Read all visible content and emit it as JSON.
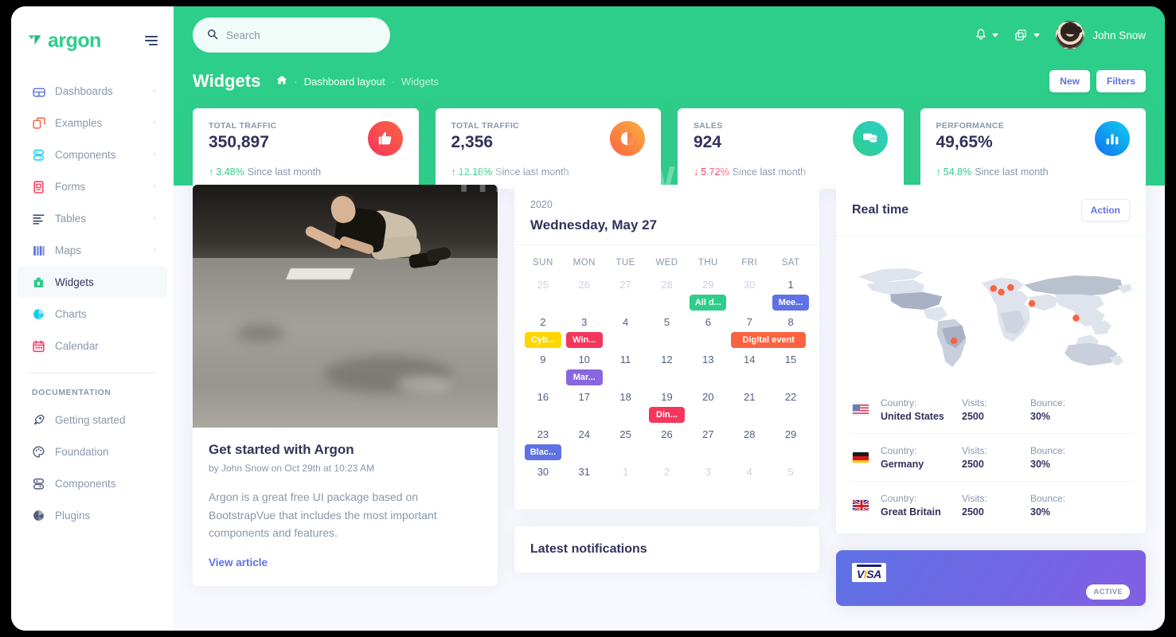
{
  "brand": {
    "name": "argon"
  },
  "sidebar": {
    "items": [
      {
        "label": "Dashboards",
        "icon": "dashboard-icon",
        "color": "#5e72e4",
        "chevron": "›",
        "active": false
      },
      {
        "label": "Examples",
        "icon": "examples-icon",
        "color": "#fb6340",
        "chevron": "›",
        "active": false
      },
      {
        "label": "Components",
        "icon": "components-icon",
        "color": "#11cdef",
        "chevron": "›",
        "active": false
      },
      {
        "label": "Forms",
        "icon": "forms-icon",
        "color": "#f5365c",
        "chevron": "›",
        "active": false
      },
      {
        "label": "Tables",
        "icon": "tables-icon",
        "color": "#344767",
        "chevron": "›",
        "active": false
      },
      {
        "label": "Maps",
        "icon": "maps-icon",
        "color": "#5e72e4",
        "chevron": "›",
        "active": false
      },
      {
        "label": "Widgets",
        "icon": "widgets-icon",
        "color": "#2dce89",
        "chevron": "",
        "active": true
      },
      {
        "label": "Charts",
        "icon": "charts-icon",
        "color": "#11cdef",
        "chevron": "",
        "active": false
      },
      {
        "label": "Calendar",
        "icon": "calendar-icon",
        "color": "#f5365c",
        "chevron": "",
        "active": false
      }
    ],
    "doc_heading": "DOCUMENTATION",
    "doc_items": [
      {
        "label": "Getting started",
        "icon": "rocket-icon"
      },
      {
        "label": "Foundation",
        "icon": "palette-icon"
      },
      {
        "label": "Components",
        "icon": "components-icon"
      },
      {
        "label": "Plugins",
        "icon": "plugins-icon"
      }
    ]
  },
  "topbar": {
    "search_placeholder": "Search",
    "search_value": "",
    "bell_icon": "bell-icon",
    "apps_icon": "windows-icon",
    "user_name": "John Snow"
  },
  "page": {
    "title": "Widgets",
    "breadcrumb_home_icon": "home-icon",
    "breadcrumb": [
      "Dashboard layout",
      "Widgets"
    ],
    "btn_new": "New",
    "btn_filters": "Filters"
  },
  "stats": [
    {
      "label": "TOTAL TRAFFIC",
      "value": "350,897",
      "delta": "3.48%",
      "delta_dir": "up",
      "delta_text": "Since last month",
      "icon": "thumbs-up-icon",
      "color_a": "#f5365c",
      "color_b": "#fb6340"
    },
    {
      "label": "TOTAL TRAFFIC",
      "value": "2,356",
      "delta": "12.18%",
      "delta_dir": "up",
      "delta_text": "Since last month",
      "icon": "pie-chart-icon",
      "color_a": "#fb6340",
      "color_b": "#fbb140"
    },
    {
      "label": "SALES",
      "value": "924",
      "delta": "5.72%",
      "delta_dir": "down",
      "delta_text": "Since last month",
      "icon": "money-icon",
      "color_a": "#2dce89",
      "color_b": "#2dcecc"
    },
    {
      "label": "PERFORMANCE",
      "value": "49,65%",
      "delta": "54.8%",
      "delta_dir": "up",
      "delta_text": "Since last month",
      "icon": "bar-chart-icon",
      "color_a": "#1171ef",
      "color_b": "#11cdef"
    }
  ],
  "article": {
    "title": "Get started with Argon",
    "meta": "by John Snow on Oct 29th at 10:23 AM",
    "description": "Argon is a great free UI package based on BootstrapVue that includes the most important components and features.",
    "link": "View article"
  },
  "calendar": {
    "year": "2020",
    "date": "Wednesday, May 27",
    "dow": [
      "SUN",
      "MON",
      "TUE",
      "WED",
      "THU",
      "FRI",
      "SAT"
    ],
    "weeks": [
      [
        {
          "n": "25",
          "mute": true
        },
        {
          "n": "26",
          "mute": true
        },
        {
          "n": "27",
          "mute": true
        },
        {
          "n": "28",
          "mute": true
        },
        {
          "n": "29",
          "mute": true,
          "event": {
            "label": "All d...",
            "color": "#2dce89"
          }
        },
        {
          "n": "30",
          "mute": true
        },
        {
          "n": "1",
          "mute": false,
          "event": {
            "label": "Mee...",
            "color": "#5e72e4"
          }
        }
      ],
      [
        {
          "n": "2",
          "event": {
            "label": "Cyb...",
            "color": "#ffd600"
          }
        },
        {
          "n": "3",
          "event": {
            "label": "Win...",
            "color": "#f5365c"
          }
        },
        {
          "n": "4"
        },
        {
          "n": "5"
        },
        {
          "n": "6"
        },
        {
          "n": "7",
          "event": {
            "label": "Digital event",
            "color": "#fb6340",
            "wide": true
          }
        },
        {
          "n": "8"
        }
      ],
      [
        {
          "n": "9"
        },
        {
          "n": "10",
          "event": {
            "label": "Mar...",
            "color": "#8965e0"
          }
        },
        {
          "n": "11"
        },
        {
          "n": "12"
        },
        {
          "n": "13"
        },
        {
          "n": "14"
        },
        {
          "n": "15"
        }
      ],
      [
        {
          "n": "16"
        },
        {
          "n": "17"
        },
        {
          "n": "18"
        },
        {
          "n": "19",
          "event": {
            "label": "Din...",
            "color": "#f5365c"
          }
        },
        {
          "n": "20"
        },
        {
          "n": "21"
        },
        {
          "n": "22"
        }
      ],
      [
        {
          "n": "23",
          "event": {
            "label": "Blac...",
            "color": "#5e72e4"
          }
        },
        {
          "n": "24"
        },
        {
          "n": "25"
        },
        {
          "n": "26"
        },
        {
          "n": "27"
        },
        {
          "n": "28"
        },
        {
          "n": "29"
        }
      ],
      [
        {
          "n": "30"
        },
        {
          "n": "31"
        },
        {
          "n": "1",
          "mute": true
        },
        {
          "n": "2",
          "mute": true
        },
        {
          "n": "3",
          "mute": true
        },
        {
          "n": "4",
          "mute": true
        },
        {
          "n": "5",
          "mute": true
        }
      ]
    ]
  },
  "notifications": {
    "title": "Latest notifications"
  },
  "realtime": {
    "title": "Real time",
    "action": "Action",
    "labels": {
      "country": "Country:",
      "visits": "Visits:",
      "bounce": "Bounce:"
    },
    "rows": [
      {
        "flag": "us-flag",
        "country": "United States",
        "visits": "2500",
        "bounce": "30%"
      },
      {
        "flag": "de-flag",
        "country": "Germany",
        "visits": "2500",
        "bounce": "30%"
      },
      {
        "flag": "gb-flag",
        "country": "Great Britain",
        "visits": "2500",
        "bounce": "30%"
      }
    ],
    "map_markers": 6,
    "marker_color": "#fb6340"
  },
  "credit_card": {
    "brand": "VISA",
    "status": "ACTIVE"
  },
  "watermark": "THESOFTWARE SHOP"
}
